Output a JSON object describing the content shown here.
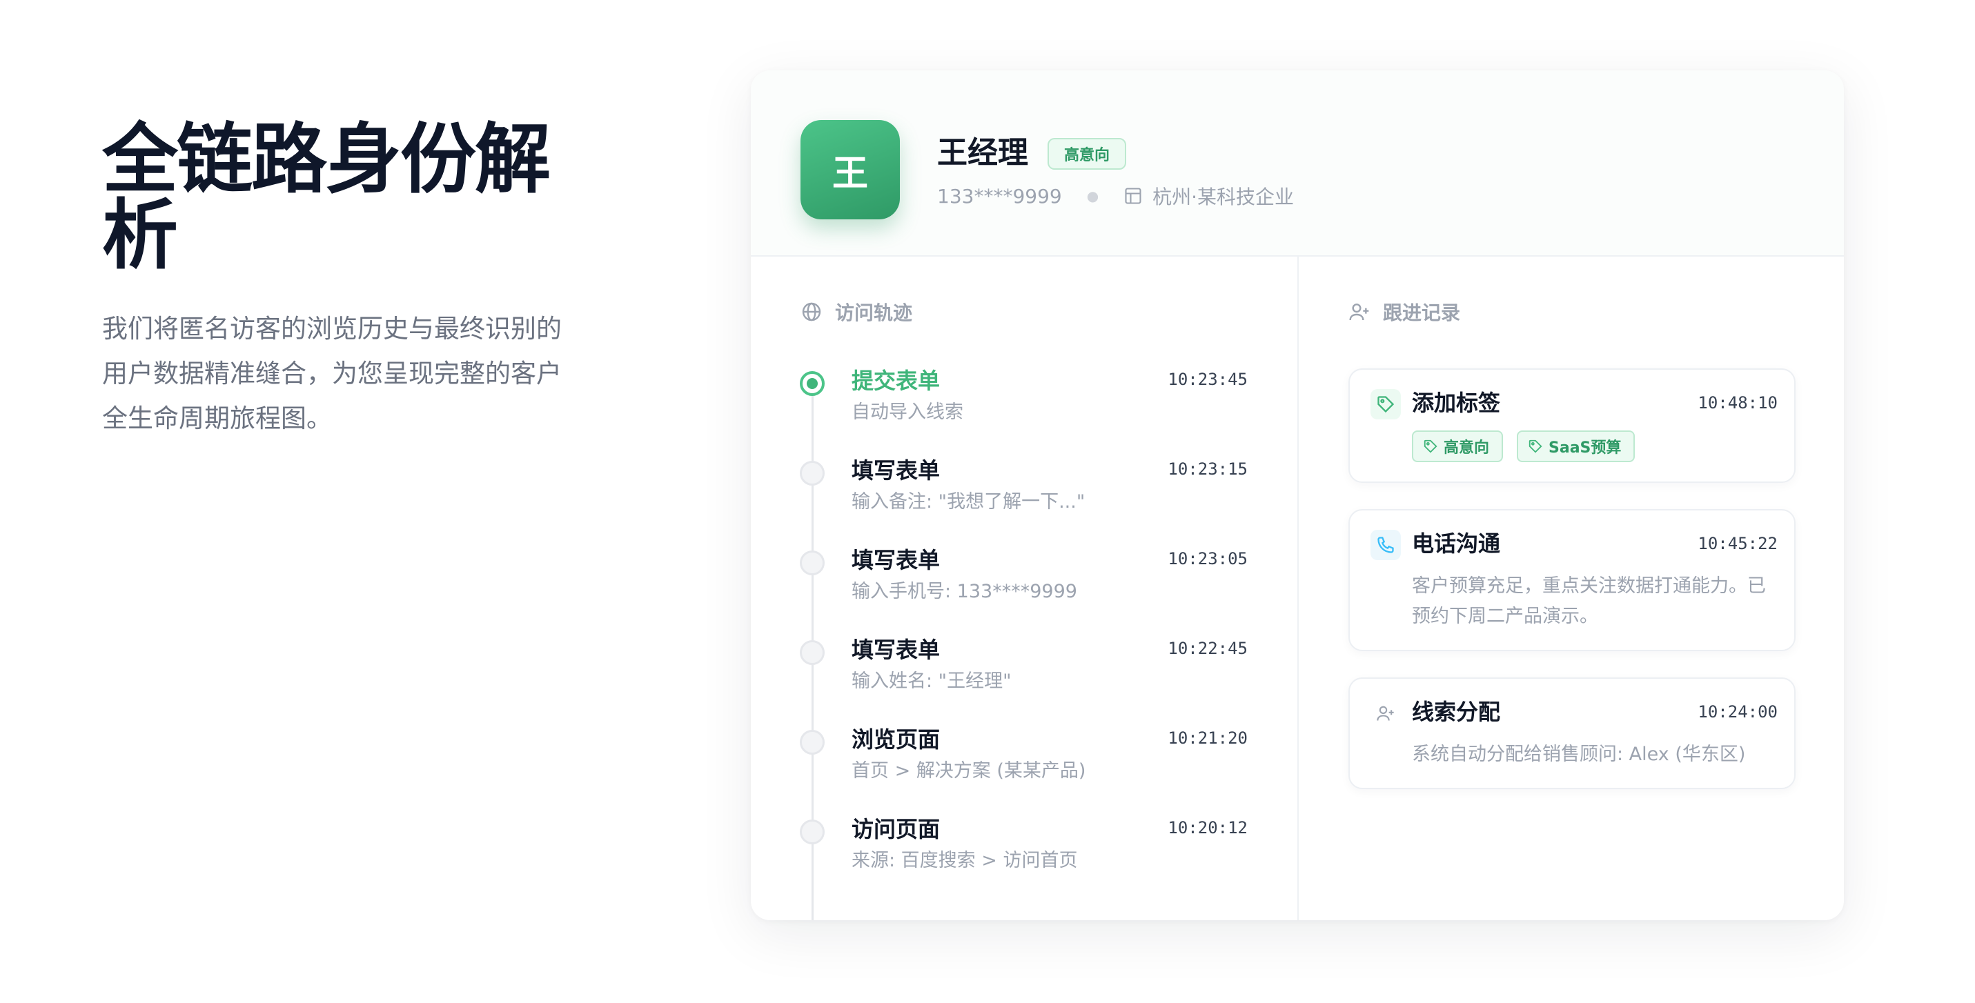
{
  "hero": {
    "title": "全链路身份解析",
    "description": "我们将匿名访客的浏览历史与最终识别的用户数据精准缝合，为您呈现完整的客户全生命周期旅程图。"
  },
  "profile": {
    "avatar_letter": "王",
    "name": "王经理",
    "intent_badge": "高意向",
    "phone": "133****9999",
    "company": "杭州·某科技企业"
  },
  "visit_track": {
    "title": "访问轨迹",
    "items": [
      {
        "title": "提交表单",
        "desc": "自动导入线索",
        "time": "10:23:45",
        "active": true
      },
      {
        "title": "填写表单",
        "desc": "输入备注: \"我想了解一下...\"",
        "time": "10:23:15",
        "active": false
      },
      {
        "title": "填写表单",
        "desc": "输入手机号: 133****9999",
        "time": "10:23:05",
        "active": false
      },
      {
        "title": "填写表单",
        "desc": "输入姓名: \"王经理\"",
        "time": "10:22:45",
        "active": false
      },
      {
        "title": "浏览页面",
        "desc": "首页 > 解决方案 (某某产品)",
        "time": "10:21:20",
        "active": false
      },
      {
        "title": "访问页面",
        "desc": "来源: 百度搜索 > 访问首页",
        "time": "10:20:12",
        "active": false
      }
    ]
  },
  "follow_up": {
    "title": "跟进记录",
    "cards": [
      {
        "title": "添加标签",
        "time": "10:48:10",
        "icon": "tag-icon",
        "tags": [
          "高意向",
          "SaaS预算"
        ]
      },
      {
        "title": "电话沟通",
        "time": "10:45:22",
        "icon": "phone-icon",
        "body": "客户预算充足，重点关注数据打通能力。已预约下周二产品演示。"
      },
      {
        "title": "线索分配",
        "time": "10:24:00",
        "icon": "user-plus-icon",
        "body": "系统自动分配给销售顾问: Alex (华东区)"
      }
    ]
  },
  "colors": {
    "accent": "#3fb57a",
    "accent_light": "#ecfaf2",
    "title": "#0f172a",
    "muted": "#9ca3af"
  }
}
